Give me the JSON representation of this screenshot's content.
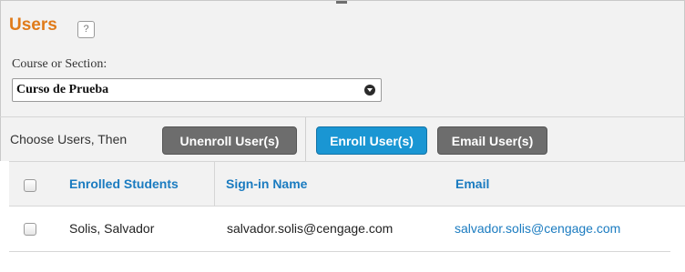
{
  "page": {
    "title": "Users",
    "help_label": "?"
  },
  "course": {
    "label": "Course or Section:",
    "selected": "Curso de Prueba"
  },
  "actions": {
    "prompt": "Choose Users, Then",
    "unenroll_label": "Unenroll User(s)",
    "enroll_label": "Enroll User(s)",
    "email_label": "Email User(s)"
  },
  "table": {
    "columns": [
      "Enrolled Students",
      "Sign-in Name",
      "Email"
    ],
    "rows": [
      {
        "name": "Solis, Salvador",
        "signin": "salvador.solis@cengage.com",
        "email": "salvador.solis@cengage.com"
      }
    ]
  },
  "colors": {
    "title_orange": "#e07b1a",
    "link_blue": "#1a7bc0",
    "primary_button": "#1a96d3",
    "secondary_button": "#6d6d6d",
    "toolbar_bg": "#f2f2f2"
  }
}
